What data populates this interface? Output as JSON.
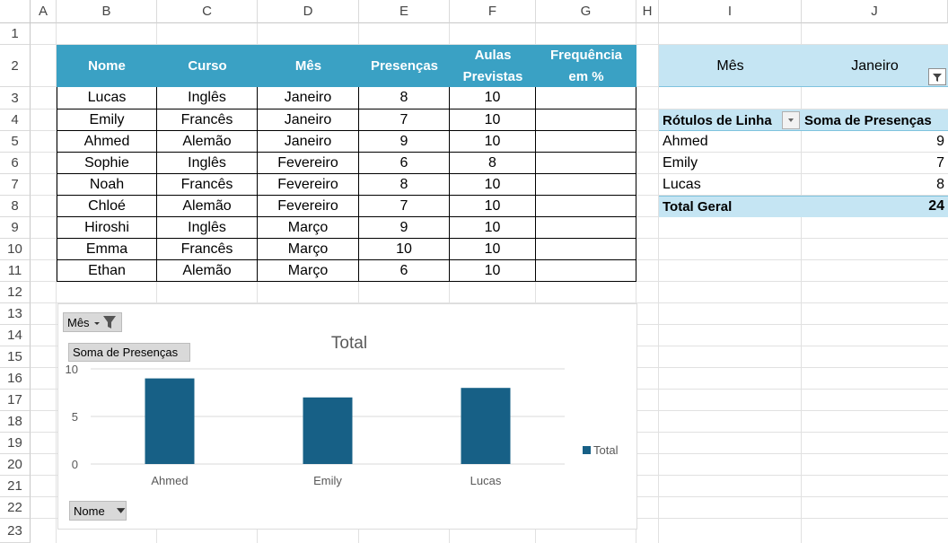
{
  "columns": [
    "A",
    "B",
    "C",
    "D",
    "E",
    "F",
    "G",
    "H",
    "I",
    "J"
  ],
  "rows": [
    "1",
    "2",
    "3",
    "4",
    "5",
    "6",
    "7",
    "8",
    "9",
    "10",
    "11",
    "12",
    "13",
    "14",
    "15",
    "16",
    "17",
    "18",
    "19",
    "20",
    "21",
    "22",
    "23"
  ],
  "table": {
    "headers": [
      "Nome",
      "Curso",
      "Mês",
      "Presenças",
      "Aulas Previstas",
      "Frequência em %"
    ],
    "data": [
      [
        "Lucas",
        "Inglês",
        "Janeiro",
        "8",
        "10",
        ""
      ],
      [
        "Emily",
        "Francês",
        "Janeiro",
        "7",
        "10",
        ""
      ],
      [
        "Ahmed",
        "Alemão",
        "Janeiro",
        "9",
        "10",
        ""
      ],
      [
        "Sophie",
        "Inglês",
        "Fevereiro",
        "6",
        "8",
        ""
      ],
      [
        "Noah",
        "Francês",
        "Fevereiro",
        "8",
        "10",
        ""
      ],
      [
        "Chloé",
        "Alemão",
        "Fevereiro",
        "7",
        "10",
        ""
      ],
      [
        "Hiroshi",
        "Inglês",
        "Março",
        "9",
        "10",
        ""
      ],
      [
        "Emma",
        "Francês",
        "Março",
        "10",
        "10",
        ""
      ],
      [
        "Ethan",
        "Alemão",
        "Março",
        "6",
        "10",
        ""
      ]
    ]
  },
  "pivot": {
    "filter_label": "Mês",
    "filter_value": "Janeiro",
    "row_labels_header": "Rótulos de Linha",
    "sum_header": "Soma de Presenças",
    "rows": [
      {
        "name": "Ahmed",
        "value": "9"
      },
      {
        "name": "Emily",
        "value": "7"
      },
      {
        "name": "Lucas",
        "value": "8"
      }
    ],
    "total_label": "Total Geral",
    "total_value": "24"
  },
  "colors": {
    "header": "#3aa1c4",
    "pivot_header": "#c5e5f3",
    "bar": "#176086"
  },
  "chart": {
    "filter_chip": "Mês",
    "value_chip": "Soma de Presenças",
    "axis_chip": "Nome"
  },
  "chart_data": {
    "type": "bar",
    "title": "Total",
    "categories": [
      "Ahmed",
      "Emily",
      "Lucas"
    ],
    "series": [
      {
        "name": "Total",
        "values": [
          9,
          7,
          8
        ]
      }
    ],
    "ylim": [
      0,
      10
    ],
    "yticks": [
      "0",
      "5",
      "10"
    ],
    "grid": true,
    "legend": "right"
  }
}
